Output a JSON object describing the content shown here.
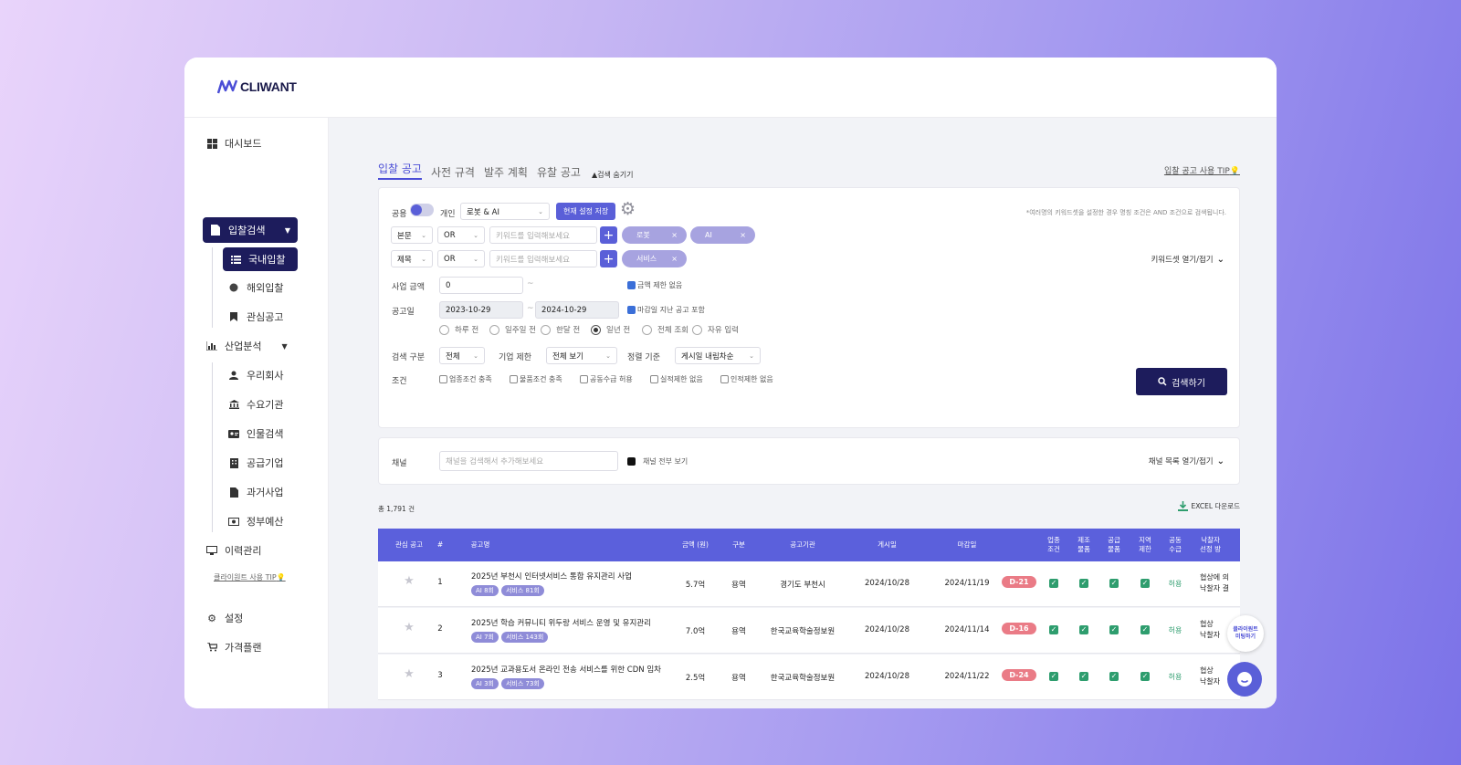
{
  "brand": {
    "name": "CLIWANT"
  },
  "sidebar": {
    "items": [
      {
        "label": "대시보드",
        "icon": "grid-icon"
      },
      {
        "label": "입찰검색",
        "icon": "document-icon"
      },
      {
        "label": "국내입찰",
        "icon": "list-icon"
      },
      {
        "label": "해외입찰",
        "icon": "globe-icon"
      },
      {
        "label": "관심공고",
        "icon": "bookmark-icon"
      },
      {
        "label": "산업분석",
        "icon": "bar-chart-icon"
      },
      {
        "label": "우리회사",
        "icon": "user-icon"
      },
      {
        "label": "수요기관",
        "icon": "institution-icon"
      },
      {
        "label": "인물검색",
        "icon": "id-card-icon"
      },
      {
        "label": "공급기업",
        "icon": "building-icon"
      },
      {
        "label": "과거사업",
        "icon": "file-icon"
      },
      {
        "label": "정부예산",
        "icon": "money-icon"
      },
      {
        "label": "이력관리",
        "icon": "monitor-icon"
      },
      {
        "label": "설정",
        "icon": "gear-icon"
      },
      {
        "label": "가격플랜",
        "icon": "cart-icon"
      }
    ],
    "tip": "클라이원트 사용 TIP"
  },
  "tabs": {
    "items": [
      "입찰 공고",
      "사전 규격",
      "발주 계획",
      "유찰 공고"
    ],
    "hide_search": "검색 숨기기",
    "usage_tip": "입찰 공고 사용 TIP"
  },
  "search": {
    "public_label": "공용",
    "personal_label": "개인",
    "keyword_set": "로봇 & AI",
    "save_btn": "현재 설정 저장",
    "note": "*여러명의 키워드셋을 설정한 경우 명칭 조건은 AND 조건으로 검색됩니다.",
    "row1": {
      "field": "본문",
      "op": "OR",
      "placeholder": "키워드를 입력해보세요",
      "chips": [
        "로봇",
        "AI"
      ]
    },
    "row2": {
      "field": "제목",
      "op": "OR",
      "placeholder": "키워드를 입력해보세요",
      "chips": [
        "서비스"
      ]
    },
    "keyword_toggle": "키워드셋 열기/접기",
    "amount_label": "사업 금액",
    "amount_value": "0",
    "amount_tilde": "~",
    "no_limit": "금액 제한 없음",
    "date_label": "공고일",
    "date_from": "2023-10-29",
    "date_to": "2024-10-29",
    "include_expired": "마감일 지난 공고 포함",
    "date_ranges": [
      "하루 전",
      "일주일 전",
      "한달 전",
      "일년 전",
      "전체 조회",
      "자유 입력"
    ],
    "date_selected": "일년 전",
    "category_label": "검색 구분",
    "category_value": "전체",
    "company_label": "기업 제한",
    "company_value": "전체 보기",
    "sort_label": "정렬 기준",
    "sort_value": "게시일 내림차순",
    "cond_label": "조건",
    "conditions": [
      "업종조건 충족",
      "물품조건 충족",
      "공동수급 허용",
      "실적제한 없음",
      "인적제한 없음"
    ],
    "search_btn": "검색하기"
  },
  "channel": {
    "label": "채널",
    "placeholder": "채널을 검색해서 추가해보세요",
    "view_all": "채널 전부 보기",
    "toggle": "채널 목록 열기/접기"
  },
  "results": {
    "total": "총 1,791 건",
    "excel": "EXCEL 다운로드",
    "headers": [
      "관심 공고",
      "#",
      "공고명",
      "금액 (원)",
      "구분",
      "공고기관",
      "게시일",
      "마감일",
      "업종\n조건",
      "제조\n물품",
      "공급\n물품",
      "지역\n제한",
      "공동\n수급",
      "낙찰자\n선정 방"
    ],
    "rows": [
      {
        "no": "1",
        "title": "2025년 부천시 인터넷서비스 통합 유지관리 사업",
        "tags": [
          "AI 8회",
          "서비스 81회"
        ],
        "amount": "5.7억",
        "type": "용역",
        "agency": "경기도 부천시",
        "posted": "2024/10/28",
        "deadline": "2024/11/19",
        "dday": "D-21",
        "joint": "허용",
        "method": "협상에 의\n낙찰자 결"
      },
      {
        "no": "2",
        "title": "2025년 학습 커뮤니티 위두랑 서비스 운영 및 유지관리",
        "tags": [
          "AI 7회",
          "서비스 143회"
        ],
        "amount": "7.0억",
        "type": "용역",
        "agency": "한국교육학술정보원",
        "posted": "2024/10/28",
        "deadline": "2024/11/14",
        "dday": "D-16",
        "joint": "허용",
        "method": "협상\n낙찰자"
      },
      {
        "no": "3",
        "title": "2025년 교과용도서 온라인 전송 서비스를 위한 CDN 임차",
        "tags": [
          "AI 3회",
          "서비스 73회"
        ],
        "amount": "2.5억",
        "type": "용역",
        "agency": "한국교육학술정보원",
        "posted": "2024/10/28",
        "deadline": "2024/11/22",
        "dday": "D-24",
        "joint": "허용",
        "method": "협상\n낙찰자"
      }
    ]
  },
  "float": {
    "label": "클라이원트\n미팅하기"
  },
  "colors": {
    "accent": "#5a5fd8",
    "navy": "#1d1c5c",
    "dday": "#ea7b86",
    "check": "#2e9d6e"
  }
}
